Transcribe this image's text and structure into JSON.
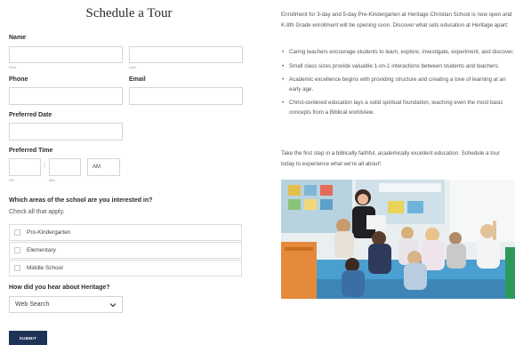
{
  "form": {
    "title": "Schedule a Tour",
    "name_label": "Name",
    "first_sub": "First",
    "last_sub": "Last",
    "phone_label": "Phone",
    "email_label": "Email",
    "date_label": "Preferred Date",
    "time_label": "Preferred Time",
    "time_colon": ":",
    "time_ampm": "AM",
    "hh_sub": "HH",
    "mm_sub": "MM",
    "areas_label": "Which areas of the school are you interested in?",
    "areas_hint": "Check all that apply.",
    "areas": [
      {
        "label": "Pro-Kindergarten"
      },
      {
        "label": "Elementary"
      },
      {
        "label": "Middle School"
      }
    ],
    "hear_label": "How did you hear about Heritage?",
    "hear_value": "Web Search",
    "submit_label": "SUBMIT"
  },
  "info": {
    "intro": "Enrollment for 3-day and 5-day Pre-Kindergarten at Heritage Christian School is now open and K-8th Grade enrollment will be opening soon. Discover what sets education at Heritage apart:",
    "bullets": [
      "Caring teachers encourage students to learn, explore, investigate, experiment, and discover.",
      "Small class sizes provide valuable 1-on-1 interactions between students and teachers.",
      "Academic excellence begins with providing structure and creating a love of learning at an early age.",
      "Christ-centered education lays a solid spiritual foundation, teaching even the most basic concepts from a Biblical worldview."
    ],
    "closing": "Take the first step in a biblically faithful, academically excellent education. Schedule a tour today to experience what we're all about!"
  },
  "colors": {
    "submit_bg": "#1f3356",
    "text": "#555555",
    "border": "#d5d5d5"
  }
}
